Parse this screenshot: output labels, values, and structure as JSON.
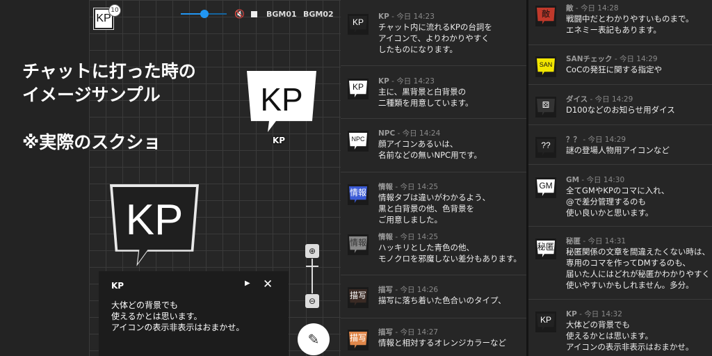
{
  "headline": "チャットに打った時の\nイメージサンプル\n\n※実際のスクショ",
  "topbar": {
    "badge": "10",
    "avatar": "KP",
    "bgm1": "BGM01",
    "bgm2": "BGM02",
    "volume": 0.5
  },
  "board": {
    "icon_large": "KP",
    "icon_small": "KP",
    "icon_small_label": "KP"
  },
  "chatbox": {
    "name": "KP",
    "text": "大体どの背景でも\n使えるかとは思います。\nアイコンの表示非表示はおまかせ。"
  },
  "colors": {
    "accent": "#2196f3",
    "blue": "#3b5bd6",
    "red": "#c0392b",
    "yellow": "#f2e600",
    "orange": "#e0874a"
  },
  "chat1": [
    {
      "name": "KP",
      "time": "今日 14:23",
      "icon": "KP",
      "text": "チャット内に流れるKPの台詞を\nアイコンで、よりわかりやすく\nしたものになります。"
    },
    {
      "name": "KP",
      "time": "今日 14:23",
      "icon": "KP",
      "text": "主に、黒背景と白背景の\n二種類を用意しています。"
    },
    {
      "name": "NPC",
      "time": "今日 14:24",
      "icon": "NPC",
      "text": "顔アイコンあるいは、\n名前などの無いNPC用です。"
    },
    {
      "name": "情報",
      "time": "今日 14:25",
      "icon": "情報",
      "text": "情報タブは違いがわかるよう、\n黒と白背景の他、色背景を\nご用意しました。"
    },
    {
      "name": "情報",
      "time": "今日 14:25",
      "icon": "情報",
      "text": "ハッキリとした青色の他、\nモノクロを邪魔しない差分もあります。"
    },
    {
      "name": "描写",
      "time": "今日 14:26",
      "icon": "描写",
      "text": "描写に落ち着いた色合いのタイプ、"
    },
    {
      "name": "描写",
      "time": "今日 14:27",
      "icon": "描写",
      "text": "情報と相対するオレンジカラーなど"
    }
  ],
  "chat2": [
    {
      "name": "敵",
      "time": "今日 14:28",
      "icon": "敵",
      "text": "戦闘中だとわかりやすいものまで。\nエネミー表記もあります。"
    },
    {
      "name": "SANチェック",
      "time": "今日 14:29",
      "icon": "SAN",
      "text": "CoCの発狂に関する指定や"
    },
    {
      "name": "ダイス",
      "time": "今日 14:29",
      "icon": "⚄",
      "text": "D100などのお知らせ用ダイス"
    },
    {
      "name": "？？",
      "time": "今日 14:29",
      "icon": "??",
      "text": "謎の登場人物用アイコンなど"
    },
    {
      "name": "GM",
      "time": "今日 14:30",
      "icon": "GM",
      "text": "全てGMやKPのコマに入れ、\n@で差分管理するのも\n使い良いかと思います。"
    },
    {
      "name": "秘匿",
      "time": "今日 14:31",
      "icon": "秘匿",
      "text": "秘匿関係の文章を間違えたくない時は、\n専用のコマを作ってDMするのも、\n届いた人にはどれが秘匿かわかりやすく\n使いやすいかもしれません。多分。"
    },
    {
      "name": "KP",
      "time": "今日 14:32",
      "icon": "KP",
      "text": "大体どの背景でも\n使えるかとは思います。\nアイコンの表示非表示はおまかせ。"
    }
  ]
}
